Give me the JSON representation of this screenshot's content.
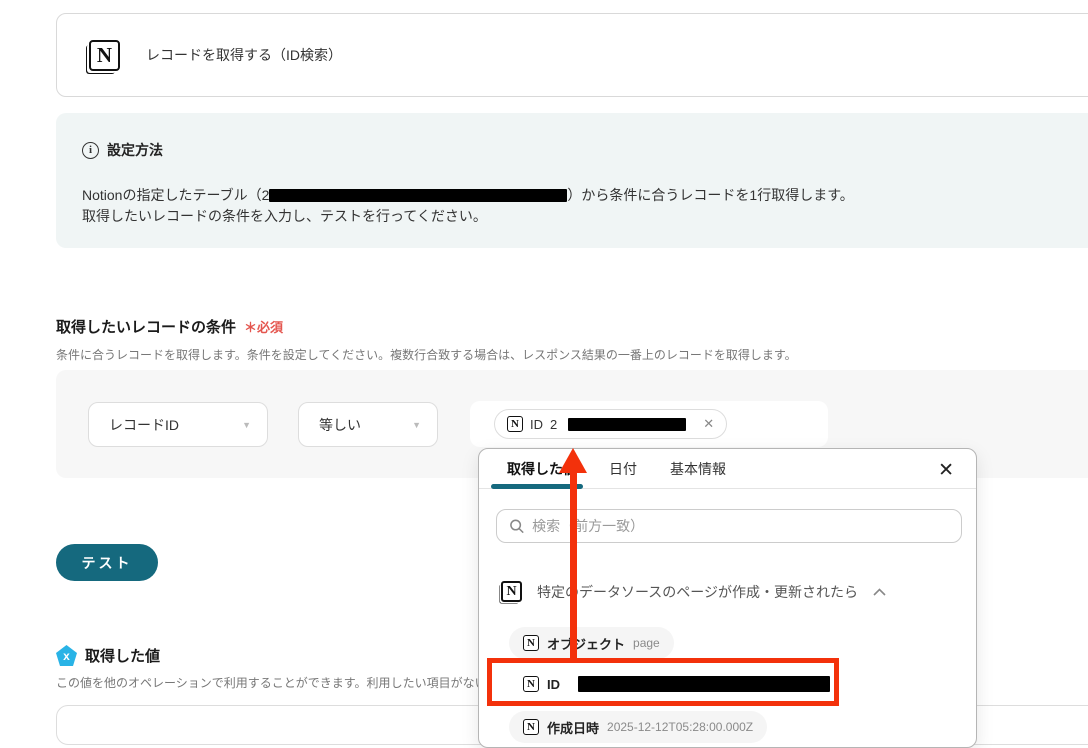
{
  "header_card": {
    "title": "レコードを取得する（ID検索）",
    "app_icon": "notion-icon"
  },
  "info_box": {
    "title": "設定方法",
    "line1_prefix": "Notionの指定したテーブル（2",
    "line1_suffix": "）から条件に合うレコードを1行取得します。",
    "line2": "取得したいレコードの条件を入力し、テストを行ってください。"
  },
  "condition": {
    "title": "取得したいレコードの条件",
    "required": "＊必須",
    "description": "条件に合うレコードを取得します。条件を設定してください。複数行合致する場合は、レスポンス結果の一番上のレコードを取得します。",
    "field_value": "レコードID",
    "operator_value": "等しい",
    "tag_label": "ID",
    "tag_prefix": "2",
    "tag_redacted": true
  },
  "test_button": {
    "label": "テスト"
  },
  "result": {
    "title": "取得した値",
    "description": "この値を他のオペレーションで利用することができます。利用したい項目がない場合は、"
  },
  "popup": {
    "tabs": [
      {
        "label": "取得した値",
        "active": true
      },
      {
        "label": "日付",
        "active": false
      },
      {
        "label": "基本情報",
        "active": false
      }
    ],
    "close_icon": "close-icon",
    "search_placeholder": "検索（前方一致）",
    "group_header": "特定のデータソースのページが作成・更新されたら",
    "items": [
      {
        "label": "オブジェクト",
        "value": "page",
        "redacted": false
      },
      {
        "label": "ID",
        "value": "",
        "redacted": true,
        "highlighted": true
      },
      {
        "label": "作成日時",
        "value": "2025-12-12T05:28:00.000Z",
        "redacted": false
      }
    ]
  },
  "colors": {
    "accent_teal": "#15697e",
    "annotation_red": "#f3310b",
    "result_icon_blue": "#29b3e6",
    "required_red": "#e4564f",
    "info_box_bg": "#f0f5f5"
  }
}
